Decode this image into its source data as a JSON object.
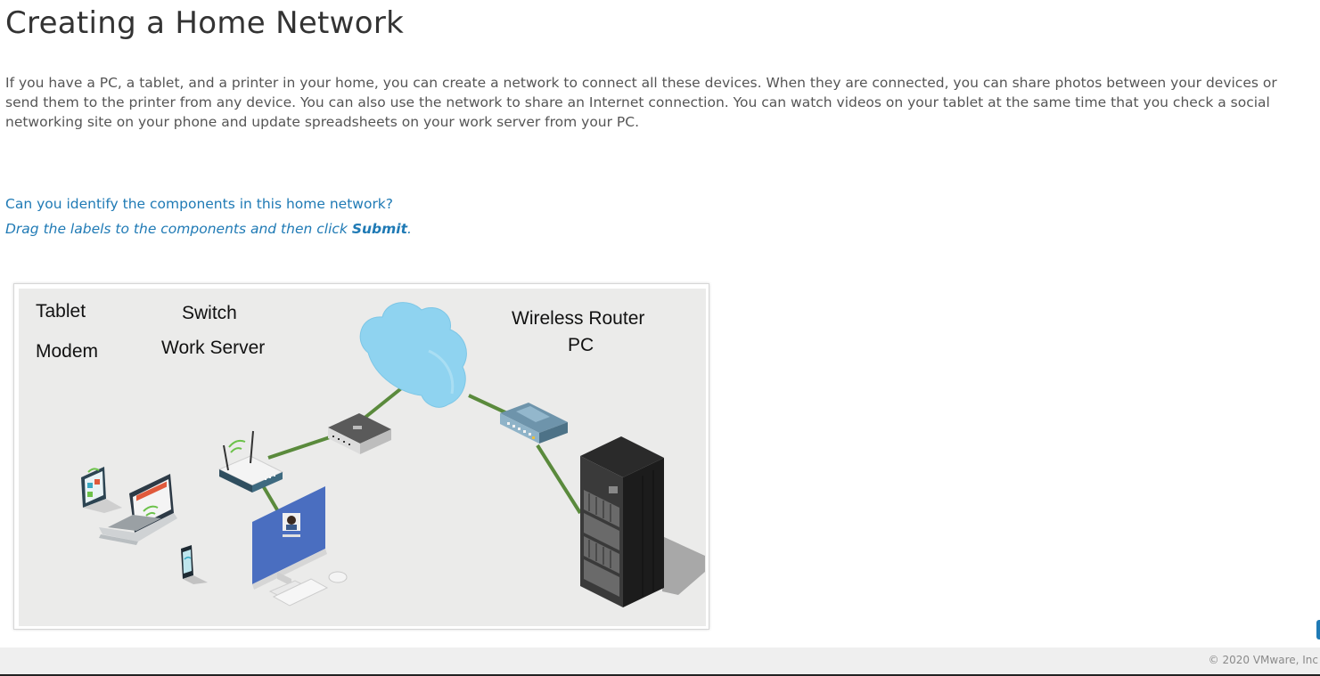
{
  "page": {
    "title": "Creating a Home Network",
    "intro": "If you have a PC, a tablet, and a printer in your home, you can create a network to connect all these devices. When they are connected, you can share photos between your devices or send them to the printer from any device. You can also use the network to share an Internet connection. You can watch videos on your tablet at the same time that you check a social networking site on your phone and update spreadsheets on your work server from your PC.",
    "question": "Can you identify the components in this home network?",
    "instruction_prefix": "Drag the labels to the components and then click ",
    "instruction_bold": "Submit",
    "instruction_suffix": "."
  },
  "diagram": {
    "labels": [
      {
        "id": "tablet",
        "text": "Tablet"
      },
      {
        "id": "switch",
        "text": "Switch"
      },
      {
        "id": "modem",
        "text": "Modem"
      },
      {
        "id": "work-server",
        "text": "Work Server"
      },
      {
        "id": "wireless-router",
        "text": "Wireless Router"
      },
      {
        "id": "pc",
        "text": "PC"
      }
    ],
    "icons": [
      "cloud-icon",
      "modem-icon",
      "wireless-router-icon",
      "switch-icon",
      "server-rack-icon",
      "pc-monitor-icon",
      "laptop-icon",
      "tablet-icon",
      "phone-icon"
    ],
    "colors": {
      "cable": "#5a8a3c",
      "cloud": "#8fd3f0",
      "background": "#ebebea",
      "accent": "#1f7ab5"
    }
  },
  "footer": {
    "copyright": "© 2020 VMware, Inc"
  }
}
